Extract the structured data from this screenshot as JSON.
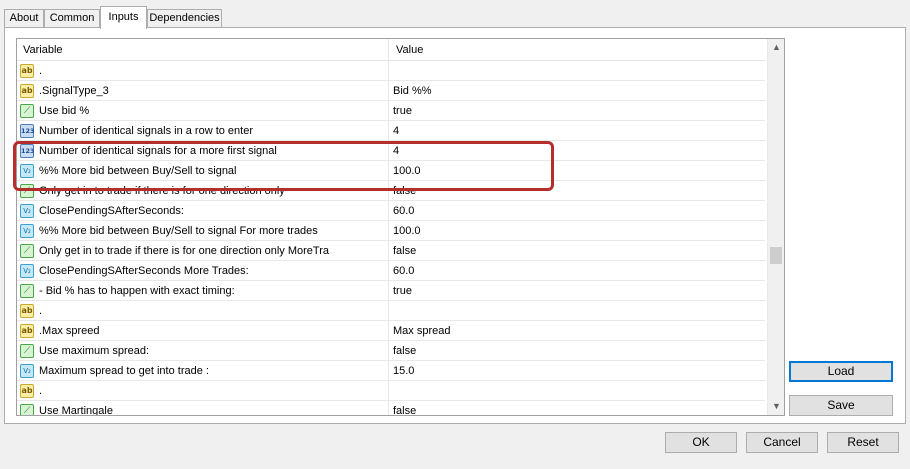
{
  "tabs": [
    {
      "label": "About"
    },
    {
      "label": "Common"
    },
    {
      "label": "Inputs"
    },
    {
      "label": "Dependencies"
    }
  ],
  "grid": {
    "headers": {
      "variable": "Variable",
      "value": "Value"
    },
    "rows": [
      {
        "icon": "ab",
        "variable": ".",
        "value": ""
      },
      {
        "icon": "ab",
        "variable": ".SignalType_3",
        "value": "Bid %%"
      },
      {
        "icon": "bool",
        "variable": "Use bid %",
        "value": "true"
      },
      {
        "icon": "n123",
        "variable": "Number of identical signals in a row to enter",
        "value": "4"
      },
      {
        "icon": "n123",
        "variable": "Number of identical signals for a more first signal",
        "value": "4"
      },
      {
        "icon": "v2",
        "variable": "%% More bid between Buy/Sell to signal",
        "value": "100.0"
      },
      {
        "icon": "bool",
        "variable": "Only get in to trade if there is for one direction only",
        "value": "false"
      },
      {
        "icon": "v2",
        "variable": "ClosePendingSAfterSeconds:",
        "value": "60.0"
      },
      {
        "icon": "v2",
        "variable": "%% More bid between Buy/Sell to signal For more trades",
        "value": "100.0"
      },
      {
        "icon": "bool",
        "variable": "Only get in to trade if there is for one direction only MoreTra",
        "value": "false"
      },
      {
        "icon": "v2",
        "variable": "ClosePendingSAfterSeconds More Trades:",
        "value": "60.0"
      },
      {
        "icon": "bool",
        "variable": "- Bid % has to happen with exact timing:",
        "value": "true"
      },
      {
        "icon": "ab",
        "variable": ".",
        "value": ""
      },
      {
        "icon": "ab",
        "variable": ".Max spreed",
        "value": "Max spread"
      },
      {
        "icon": "bool",
        "variable": "Use maximum spread:",
        "value": "false"
      },
      {
        "icon": "v2",
        "variable": "Maximum spread to get into trade :",
        "value": "15.0"
      },
      {
        "icon": "ab",
        "variable": ".",
        "value": ""
      },
      {
        "icon": "bool",
        "variable": "Use Martingale",
        "value": "false"
      }
    ]
  },
  "icon_glyphs": {
    "ab": "ab",
    "n123": "123",
    "v2": "V₂",
    "bool": "⟋"
  },
  "buttons": {
    "load": "Load",
    "save": "Save",
    "ok": "OK",
    "cancel": "Cancel",
    "reset": "Reset"
  },
  "colors": {
    "highlight": "#b52e2e",
    "focus": "#0078d7"
  }
}
